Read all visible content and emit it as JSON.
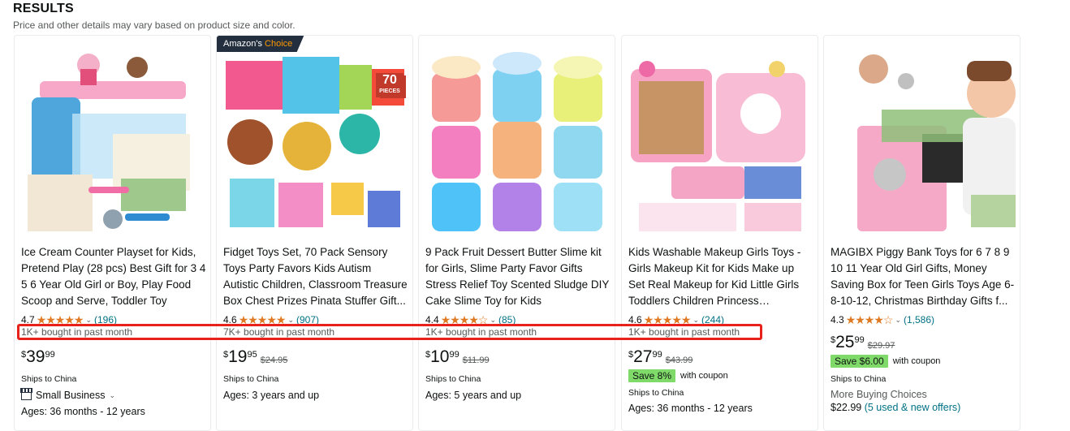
{
  "header": {
    "title": "RESULTS",
    "subtitle": "Price and other details may vary based on product size and color."
  },
  "colors": {
    "star": "#de7921",
    "link": "#007185",
    "save_badge": "#7fda69",
    "highlight": "#e8221b",
    "badge_bg": "#232f3e"
  },
  "products": [
    {
      "title": "Ice Cream Counter Playset for Kids, Pretend Play (28 pcs) Best Gift for 3 4 5 6 Year Old Girl or Boy, Play Food Scoop and Serve, Toddler Toy",
      "rating": "4.7",
      "stars": 4.7,
      "reviews": "(196)",
      "bought": "1K+ bought in past month",
      "price_symbol": "$",
      "price_whole": "39",
      "price_fraction": "99",
      "ships": "Ships to China",
      "small_business": "Small Business",
      "ages": "Ages: 36 months - 12 years"
    },
    {
      "badge_prefix": "Amazon's",
      "badge_choice": "Choice",
      "title": "Fidget Toys Set, 70 Pack Sensory Toys Party Favors Kids Autism Autistic Children, Classroom Treasure Box Chest Prizes Pinata Stuffer Gift...",
      "rating": "4.6",
      "stars": 4.6,
      "reviews": "(907)",
      "bought": "7K+ bought in past month",
      "price_symbol": "$",
      "price_whole": "19",
      "price_fraction": "95",
      "list_price": "$24.95",
      "ships": "Ships to China",
      "ages": "Ages: 3 years and up",
      "image_text": "70",
      "image_subtext": "PIECES"
    },
    {
      "title": "9 Pack Fruit Dessert Butter Slime kit for Girls, Slime Party Favor Gifts Stress Relief Toy Scented Sludge DIY Cake Slime Toy for Kids",
      "rating": "4.4",
      "stars": 4.4,
      "reviews": "(85)",
      "bought": "1K+ bought in past month",
      "price_symbol": "$",
      "price_whole": "10",
      "price_fraction": "99",
      "list_price": "$11.99",
      "ships": "Ships to China",
      "ages": "Ages: 5 years and up"
    },
    {
      "title": "Kids Washable Makeup Girls Toys - Girls Makeup Kit for Kids Make up Set Real Makeup for Kid Little Girls Toddlers Children Princess Christmas...",
      "rating": "4.6",
      "stars": 4.6,
      "reviews": "(244)",
      "bought": "1K+ bought in past month",
      "price_symbol": "$",
      "price_whole": "27",
      "price_fraction": "99",
      "list_price": "$43.99",
      "coupon_badge": "Save 8%",
      "coupon_text": "with coupon",
      "ships": "Ships to China",
      "ages": "Ages: 36 months - 12 years"
    },
    {
      "title": "MAGIBX Piggy Bank Toys for 6 7 8 9 10 11 Year Old Girl Gifts, Money Saving Box for Teen Girls Toys Age 6-8-10-12, Christmas Birthday Gifts f...",
      "rating": "4.3",
      "stars": 4.3,
      "reviews": "(1,586)",
      "price_symbol": "$",
      "price_whole": "25",
      "price_fraction": "99",
      "list_price": "$29.97",
      "coupon_badge": "Save $6.00",
      "coupon_text": "with coupon",
      "ships": "Ships to China",
      "more_buying": "More Buying Choices",
      "offer_price": "$22.99",
      "offer_link": "(5 used & new offers)"
    }
  ]
}
